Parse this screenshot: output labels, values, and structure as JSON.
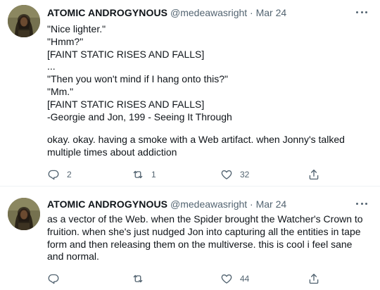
{
  "tweets": [
    {
      "author": {
        "name": "ATOMIC ANDROGYNOUS",
        "handle": "@medeawasright",
        "separator": "·",
        "date": "Mar 24"
      },
      "lines": [
        "\"Nice lighter.\"",
        "\"Hmm?\"",
        "[FAINT STATIC RISES AND FALLS]",
        "...",
        "\"Then you won't mind if I hang onto this?\"",
        "\"Mm.\"",
        "[FAINT STATIC RISES AND FALLS]",
        "-Georgie and Jon, 199 - Seeing It Through"
      ],
      "paragraph": "okay. okay. having a smoke with a Web artifact. when Jonny's talked multiple times about addiction",
      "actions": {
        "replies": "2",
        "retweets": "1",
        "likes": "32"
      }
    },
    {
      "author": {
        "name": "ATOMIC ANDROGYNOUS",
        "handle": "@medeawasright",
        "separator": "·",
        "date": "Mar 24"
      },
      "paragraph": "as a vector of the Web. when the Spider brought the Watcher's Crown to fruition. when she's just nudged Jon into capturing all the entities in tape form and then releasing them on the multiverse. this is cool i feel sane and normal.",
      "actions": {
        "replies": "",
        "retweets": "",
        "likes": "44"
      }
    }
  ],
  "icons": [
    "reply-icon",
    "retweet-icon",
    "like-icon",
    "share-icon",
    "more-icon"
  ],
  "colors": {
    "text": "#0f1419",
    "secondary": "#536471",
    "divider": "#eff3f4"
  }
}
